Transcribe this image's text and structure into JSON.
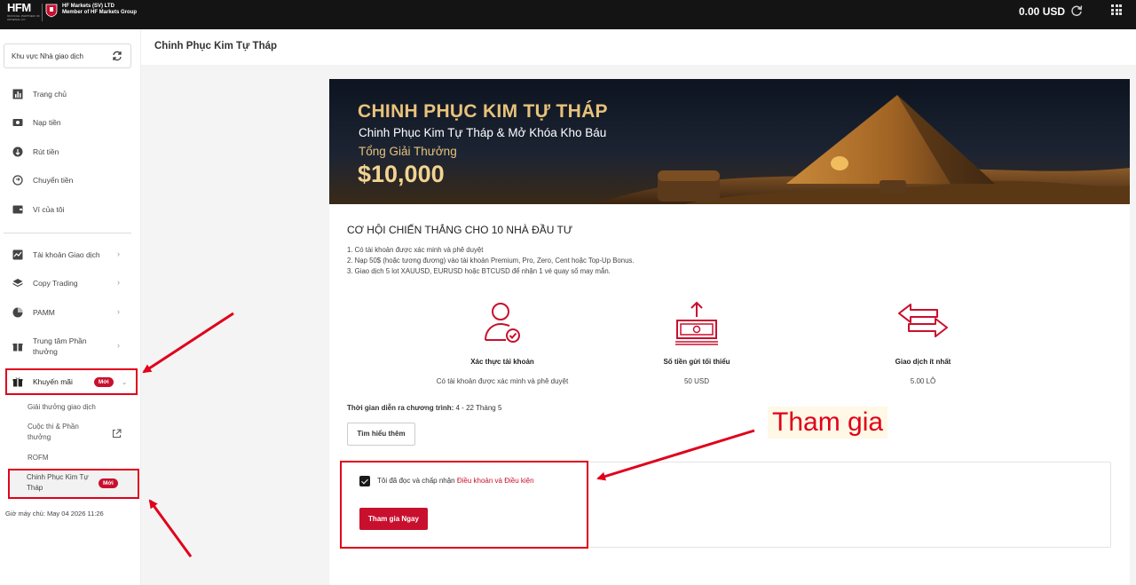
{
  "topbar": {
    "logo_text": "HFM",
    "logo_sub": "OFFICIAL PARTNER OF ARSENAL FC",
    "company_line1": "HF Markets (SV) LTD",
    "company_line2": "Member of HF Markets Group",
    "balance": "0.00 USD",
    "icons": [
      "refresh-icon",
      "apps-grid-icon"
    ]
  },
  "sidebar": {
    "region_label": "Khu vực Nhà giao dịch",
    "items": [
      {
        "label": "Trang chủ",
        "icon": "chart-icon"
      },
      {
        "label": "Nạp tiền",
        "icon": "deposit-icon"
      },
      {
        "label": "Rút tiền",
        "icon": "withdraw-icon"
      },
      {
        "label": "Chuyển tiền",
        "icon": "transfer-icon"
      },
      {
        "label": "Ví của tôi",
        "icon": "wallet-icon"
      },
      {
        "label": "Tài khoản Giao dịch",
        "icon": "trading-account-icon"
      },
      {
        "label": "Copy Trading",
        "icon": "layers-icon"
      },
      {
        "label": "PAMM",
        "icon": "pie-icon"
      },
      {
        "label": "Trung tâm Phần thưởng",
        "icon": "gift-icon"
      },
      {
        "label": "Khuyến mãi",
        "icon": "gift-icon",
        "badge": "Mới"
      }
    ],
    "sub_items": [
      {
        "label": "Giải thưởng giao dịch"
      },
      {
        "label": "Cuộc thi & Phần thưởng"
      },
      {
        "label": "ROFM"
      },
      {
        "label": "Chinh Phục Kim Tự Tháp",
        "badge": "Mới"
      }
    ],
    "server_time": "Giờ máy chủ: May 04 2026 11:26"
  },
  "header": {
    "title": "Chinh Phục Kim Tự Tháp"
  },
  "banner": {
    "title": "CHINH PHỤC KIM TỰ THÁP",
    "subtitle": "Chinh Phục Kim Tự Tháp & Mở Khóa Kho Báu",
    "prize_label": "Tổng Giải Thưởng",
    "prize_amount": "$10,000"
  },
  "content": {
    "section_title": "CƠ HỘI CHIẾN THẮNG CHO 10 NHÀ ĐẦU TƯ",
    "rules": [
      "1. Có tài khoản được xác minh và phê duyệt",
      "2. Nạp 50$ (hoặc tương đương) vào tài khoản Premium, Pro, Zero, Cent hoặc Top-Up Bonus.",
      "3. Giao dịch 5 lot XAUUSD, EURUSD hoặc BTCUSD để nhận 1 vé quay số may mắn."
    ],
    "features": [
      {
        "title": "Xác thực tài khoản",
        "value": "Có tài khoản được xác minh và phê duyệt",
        "icon": "user-check-icon"
      },
      {
        "title": "Số tiền gửi tối thiểu",
        "value": "50 USD",
        "icon": "money-deposit-icon"
      },
      {
        "title": "Giao dịch ít nhất",
        "value": "5.00 LÔ",
        "icon": "exchange-arrows-icon"
      }
    ],
    "period_label": "Thời gian diễn ra chương trình:",
    "period_value": " 4 - 22 Tháng 5",
    "learn_more": "Tìm hiểu thêm",
    "terms_prefix": "Tôi đã đọc và chấp nhận ",
    "terms_link": "Điều khoản và Điều kiện",
    "join_button": "Tham gia Ngay"
  },
  "annotation": {
    "label": "Tham gia",
    "color": "#e0001b"
  }
}
